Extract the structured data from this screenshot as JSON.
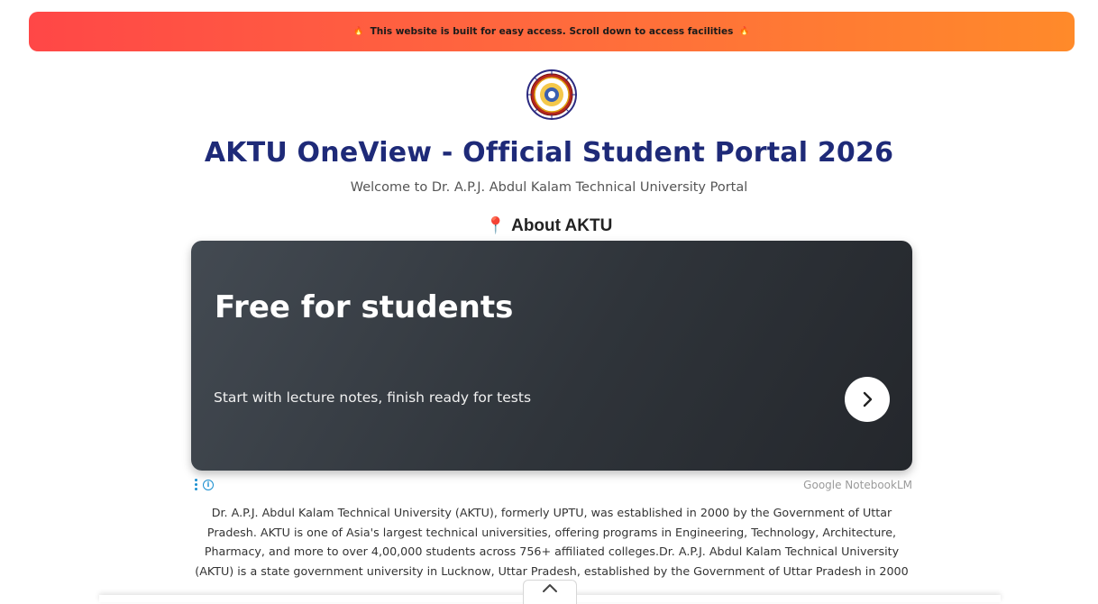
{
  "banner": {
    "text": "This website is built for easy access. Scroll down to access facilities",
    "left_emoji": "🔥",
    "right_emoji": "🔥"
  },
  "header": {
    "title": "AKTU OneView - Official Student Portal 2026",
    "subtitle": "Welcome to Dr. A.P.J. Abdul Kalam Technical University Portal"
  },
  "about": {
    "heading": "About AKTU",
    "heading_icon": "📍",
    "paragraph": "Dr. A.P.J. Abdul Kalam Technical University (AKTU), formerly UPTU, was established in 2000 by the Government of Uttar Pradesh. AKTU is one of Asia's largest technical universities, offering programs in Engineering, Technology, Architecture, Pharmacy, and more to over 4,00,000 students across 756+ affiliated colleges.Dr. A.P.J. Abdul Kalam Technical University (AKTU) is a state government university in Lucknow, Uttar Pradesh, established by the Government of Uttar Pradesh in 2000"
  },
  "ad": {
    "heading": "Free for students",
    "subtext": "Start with lecture notes, finish ready for tests",
    "source": "Google NotebookLM",
    "info_glyph": "i"
  },
  "colors": {
    "title": "#1e2a78",
    "banner_start": "#ff4747",
    "banner_end": "#ff8a2a",
    "card_bg": "#2f343a",
    "info_blue": "#1a8fd0"
  }
}
